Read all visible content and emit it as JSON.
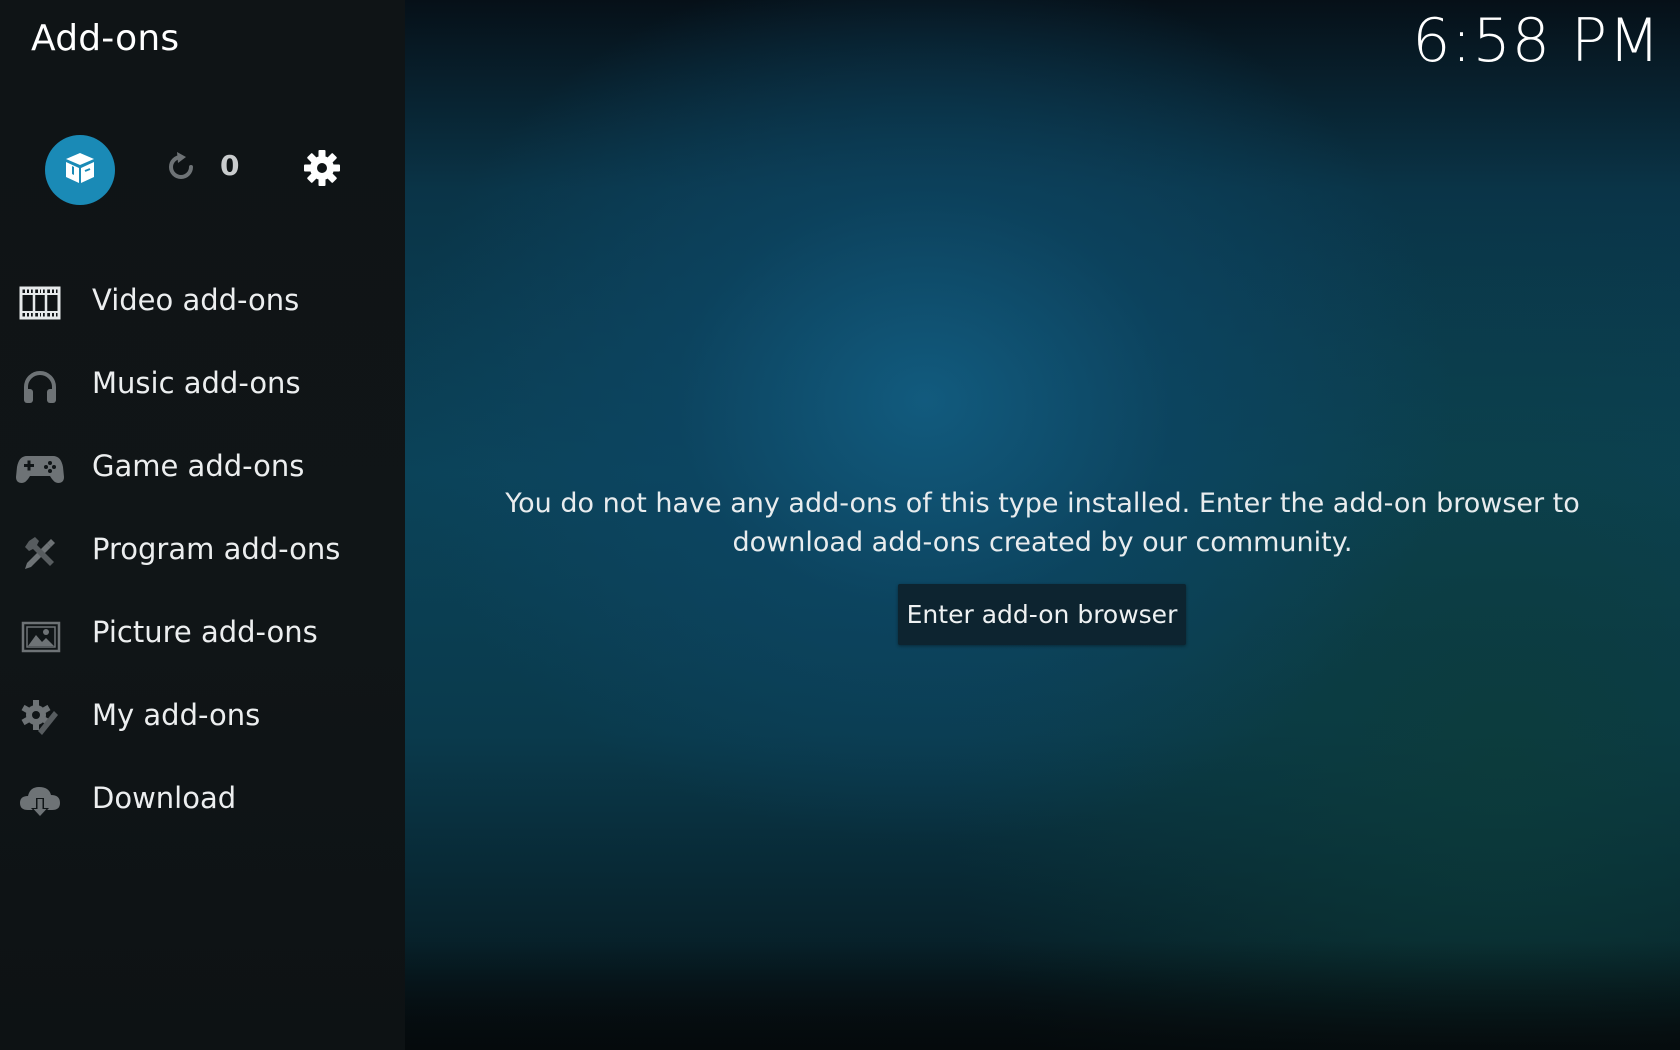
{
  "header": {
    "title": "Add-ons",
    "clock": "6:58 PM"
  },
  "toolbar": {
    "addon_browser_icon": "open-box-icon",
    "update_icon": "refresh-icon",
    "update_count": "0",
    "settings_icon": "gear-icon",
    "accent_color": "#1a8ab6"
  },
  "sidebar": {
    "items": [
      {
        "label": "Video add-ons",
        "icon": "film-icon"
      },
      {
        "label": "Music add-ons",
        "icon": "headphones-icon"
      },
      {
        "label": "Game add-ons",
        "icon": "gamepad-icon"
      },
      {
        "label": "Program add-ons",
        "icon": "tools-icon"
      },
      {
        "label": "Picture add-ons",
        "icon": "picture-icon"
      },
      {
        "label": "My add-ons",
        "icon": "cogs-icon"
      },
      {
        "label": "Download",
        "icon": "cloud-download-icon"
      }
    ]
  },
  "main": {
    "message": "You do not have any add-ons of this type installed. Enter the add-on browser to download add-ons created by our community.",
    "button_label": "Enter add-on browser"
  }
}
